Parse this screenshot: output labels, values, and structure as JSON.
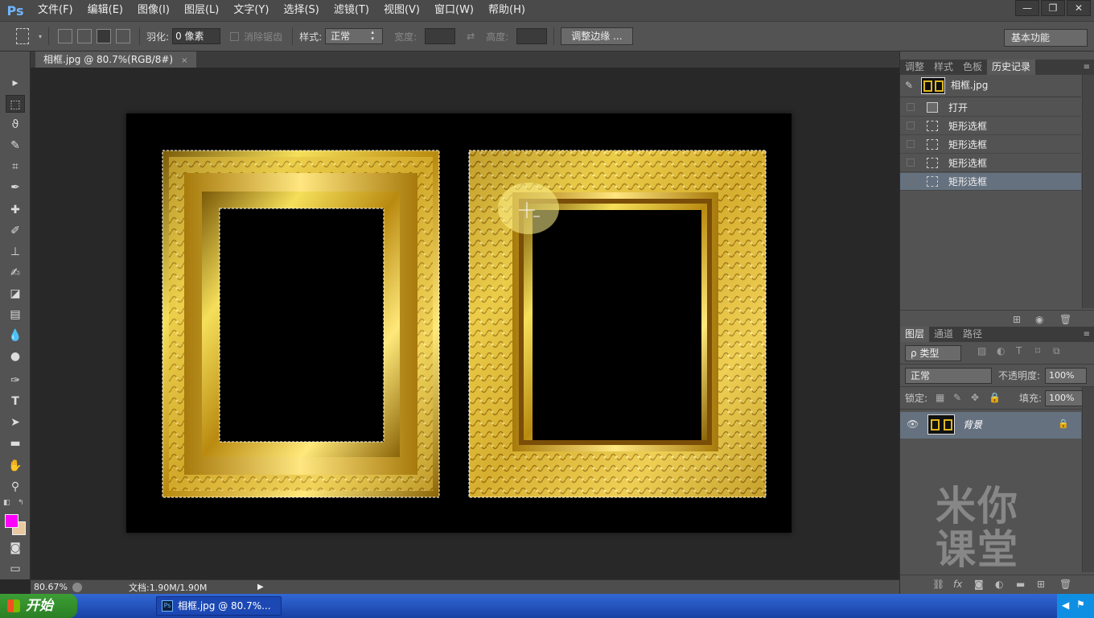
{
  "app": {
    "logo": "Ps",
    "menu": [
      "文件(F)",
      "编辑(E)",
      "图像(I)",
      "图层(L)",
      "文字(Y)",
      "选择(S)",
      "滤镜(T)",
      "视图(V)",
      "窗口(W)",
      "帮助(H)"
    ],
    "window_controls": [
      "—",
      "❐",
      "✕"
    ]
  },
  "options": {
    "feather_label": "羽化:",
    "feather_value": "0 像素",
    "antialias_label": "消除锯齿",
    "style_label": "样式:",
    "style_value": "正常",
    "width_label": "宽度:",
    "height_label": "高度:",
    "refine_button": "调整边缘 ...",
    "workspace": "基本功能"
  },
  "document": {
    "tab_title": "相框.jpg @ 80.7%(RGB/8#)",
    "close_glyph": "×"
  },
  "status": {
    "zoom": "80.67%",
    "doc_size": "文档:1.90M/1.90M"
  },
  "panels": {
    "top_tabs": [
      "调整",
      "样式",
      "色板",
      "历史记录"
    ],
    "history": {
      "snapshot": "相框.jpg",
      "items": [
        "打开",
        "矩形选框",
        "矩形选框",
        "矩形选框",
        "矩形选框"
      ],
      "active_index": 4
    },
    "layers_tabs": [
      "图层",
      "通道",
      "路径"
    ],
    "layers": {
      "filter_kind": "ρ 类型",
      "blend_mode": "正常",
      "opacity_label": "不透明度:",
      "opacity_value": "100%",
      "lock_label": "锁定:",
      "fill_label": "填充:",
      "fill_value": "100%",
      "layer_name": "背景"
    },
    "watermark": "米你课堂"
  },
  "taskbar": {
    "start_label": "开始",
    "task_label": "相框.jpg @ 80.7%..."
  },
  "colors": {
    "foreground": "#ff00ff",
    "background": "#e8c9a0",
    "accent": "#65717f"
  }
}
